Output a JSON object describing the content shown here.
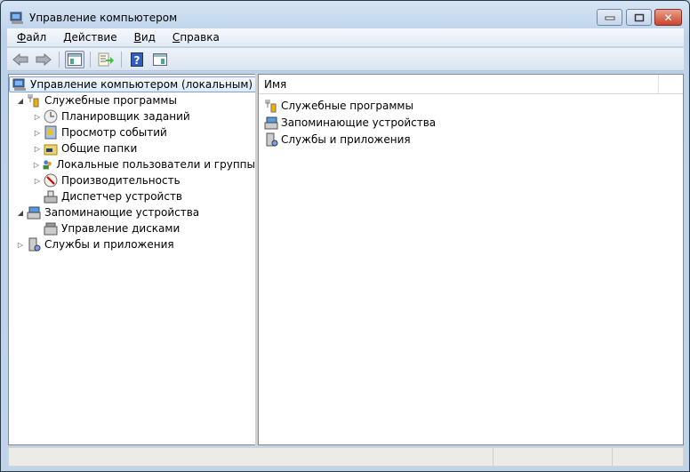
{
  "window": {
    "title": "Управление компьютером",
    "minimize": "–",
    "maximize": "□",
    "close": "✕"
  },
  "menu": [
    {
      "label": "Файл",
      "accel": "Ф",
      "rest": "айл"
    },
    {
      "label": "Действие",
      "accel": "Д",
      "rest": "ействие"
    },
    {
      "label": "Вид",
      "accel": "В",
      "rest": "ид"
    },
    {
      "label": "Справка",
      "accel": "С",
      "rest": "правка"
    }
  ],
  "tree": {
    "root": "Управление компьютером (локальным)",
    "items": [
      {
        "label": "Служебные программы",
        "level": 1,
        "arrow": "◢",
        "icon": "tools-icon"
      },
      {
        "label": "Планировщик заданий",
        "level": 2,
        "arrow": "▷",
        "icon": "clock-icon"
      },
      {
        "label": "Просмотр событий",
        "level": 2,
        "arrow": "▷",
        "icon": "event-viewer-icon"
      },
      {
        "label": "Общие папки",
        "level": 2,
        "arrow": "▷",
        "icon": "shared-folder-icon"
      },
      {
        "label": "Локальные пользователи и группы",
        "level": 2,
        "arrow": "▷",
        "icon": "users-icon"
      },
      {
        "label": "Производительность",
        "level": 2,
        "arrow": "▷",
        "icon": "performance-icon"
      },
      {
        "label": "Диспетчер устройств",
        "level": 2,
        "arrow": "",
        "icon": "device-manager-icon"
      },
      {
        "label": "Запоминающие устройства",
        "level": 1,
        "arrow": "◢",
        "icon": "storage-icon"
      },
      {
        "label": "Управление дисками",
        "level": 2,
        "arrow": "",
        "icon": "disk-management-icon"
      },
      {
        "label": "Службы и приложения",
        "level": 1,
        "arrow": "▷",
        "icon": "services-icon"
      }
    ]
  },
  "list": {
    "column": "Имя",
    "items": [
      "Служебные программы",
      "Запоминающие устройства",
      "Службы и приложения"
    ]
  }
}
